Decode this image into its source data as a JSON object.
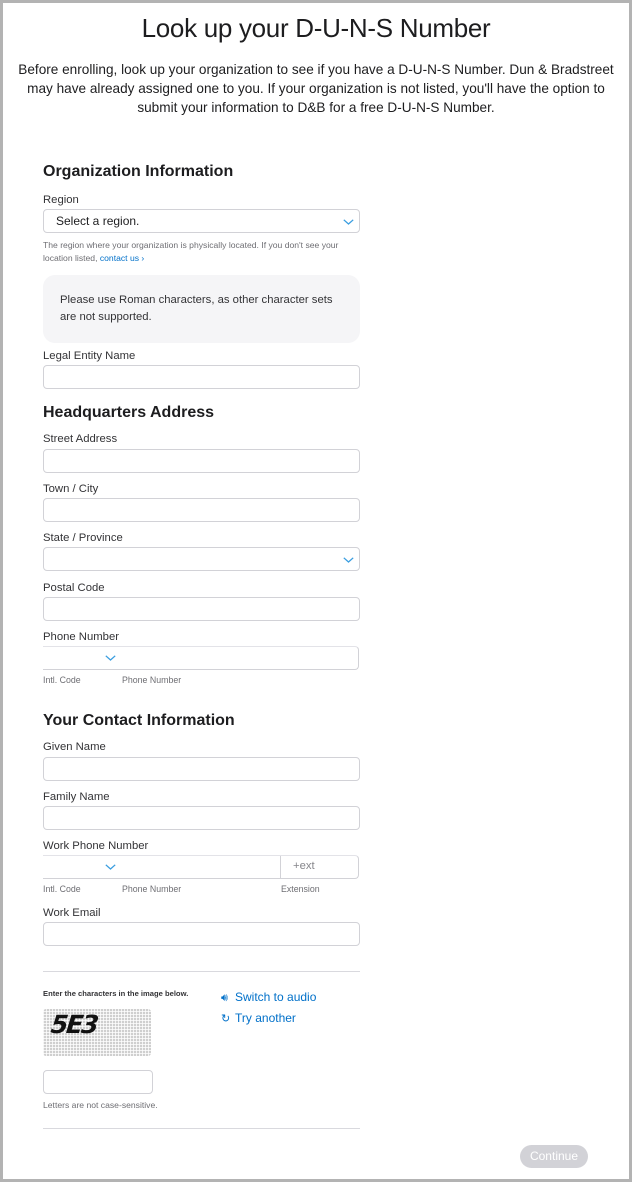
{
  "header": {
    "title": "Look up your D-U-N-S Number",
    "intro": "Before enrolling, look up your organization to see if you have a D-U-N-S Number. Dun & Bradstreet may have already assigned one to you. If your organization is not listed, you'll have the option to submit your information to D&B for a free D-U-N-S Number."
  },
  "organization": {
    "section_title": "Organization Information",
    "region": {
      "label": "Region",
      "selected": "Select a region.",
      "hint": "The region where your organization is physically located. If you don't see your location listed, ",
      "hint_link": "contact us ›"
    },
    "notice": "Please use Roman characters, as other character sets are not supported.",
    "legal_entity_name": {
      "label": "Legal Entity Name",
      "value": ""
    }
  },
  "headquarters": {
    "section_title": "Headquarters Address",
    "street_address": {
      "label": "Street Address",
      "value": ""
    },
    "town_city": {
      "label": "Town / City",
      "value": ""
    },
    "state_province": {
      "label": "State / Province",
      "selected": ""
    },
    "postal_code": {
      "label": "Postal Code",
      "value": ""
    },
    "phone_number": {
      "label": "Phone Number",
      "intl_code_label": "Intl. Code",
      "number_label": "Phone Number",
      "value": ""
    }
  },
  "contact": {
    "section_title": "Your Contact Information",
    "given_name": {
      "label": "Given Name",
      "value": ""
    },
    "family_name": {
      "label": "Family Name",
      "value": ""
    },
    "work_phone": {
      "label": "Work Phone Number",
      "intl_code_label": "Intl. Code",
      "number_label": "Phone Number",
      "extension_label": "Extension",
      "extension_placeholder": "+ext"
    },
    "work_email": {
      "label": "Work Email",
      "value": ""
    }
  },
  "captcha": {
    "instruction": "Enter the characters in the image below.",
    "image_text": "5E3",
    "switch_audio": "Switch to audio",
    "try_another": "Try another",
    "hint": "Letters are not case-sensitive.",
    "value": ""
  },
  "actions": {
    "continue_label": "Continue"
  },
  "colors": {
    "accent": "#0070c9",
    "disabled_button": "#d2d2d7",
    "notice_bg": "#f5f5f7"
  }
}
